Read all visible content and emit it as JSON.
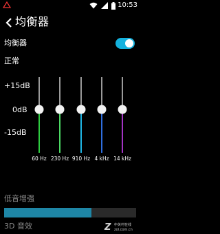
{
  "status_bar": {
    "time": "10:53",
    "icons": [
      "sim-error-icon",
      "wifi-icon",
      "signal-icon",
      "battery-icon"
    ]
  },
  "header": {
    "title": "均衡器",
    "back_icon": "chevron-left-icon"
  },
  "equalizer": {
    "label": "均衡器",
    "enabled": true,
    "preset": "正常",
    "db_labels": [
      "+15dB",
      "0dB",
      "-15dB"
    ],
    "range_db": [
      -15,
      15
    ],
    "bands": [
      {
        "freq": "60 Hz",
        "gain_db": 0,
        "color": "#2ecc40"
      },
      {
        "freq": "230 Hz",
        "gain_db": 0,
        "color": "#4cd964"
      },
      {
        "freq": "910 Hz",
        "gain_db": 0,
        "color": "#1fb7e6"
      },
      {
        "freq": "4 kHz",
        "gain_db": 0,
        "color": "#2f6fe0"
      },
      {
        "freq": "14 kHz",
        "gain_db": 0,
        "color": "#a334c4"
      }
    ],
    "slider_top_color": "#9a9a9a",
    "accent": "#14b1dd"
  },
  "bass_boost": {
    "label": "低音增强",
    "level": 0.66
  },
  "virtualizer": {
    "label": "3D 音效"
  },
  "watermark": {
    "line1": "中关村在线",
    "line2": "zol.com.cn"
  }
}
